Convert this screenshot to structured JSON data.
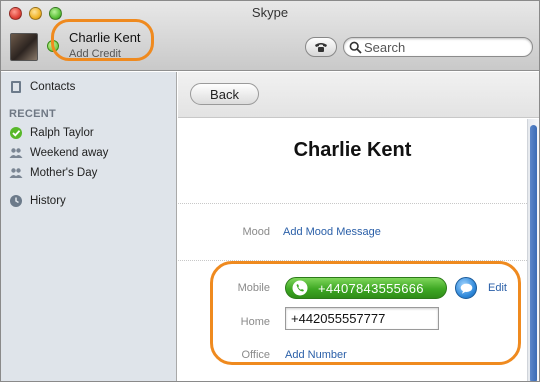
{
  "window": {
    "title": "Skype"
  },
  "account": {
    "name": "Charlie Kent",
    "credit_link": "Add Credit"
  },
  "search": {
    "placeholder": "Search"
  },
  "sidebar": {
    "contacts_label": "Contacts",
    "recent_heading": "RECENT",
    "recent_items": [
      {
        "label": "Ralph Taylor",
        "icon": "online-status-icon"
      },
      {
        "label": "Weekend away",
        "icon": "group-icon"
      },
      {
        "label": "Mother's Day",
        "icon": "group-icon"
      }
    ],
    "history_label": "History"
  },
  "detail": {
    "back_label": "Back",
    "contact_name": "Charlie Kent",
    "mood": {
      "label": "Mood",
      "action": "Add Mood Message"
    },
    "mobile": {
      "label": "Mobile",
      "number": "+4407843555666",
      "edit": "Edit"
    },
    "home": {
      "label": "Home",
      "number": "+442055557777"
    },
    "office": {
      "label": "Office",
      "action": "Add Number"
    }
  },
  "colors": {
    "accent_highlight": "#ef8a1f",
    "call_green": "#3ea824",
    "link_blue": "#2a5fa8",
    "sidebar_bg": "#dfe4ea"
  }
}
